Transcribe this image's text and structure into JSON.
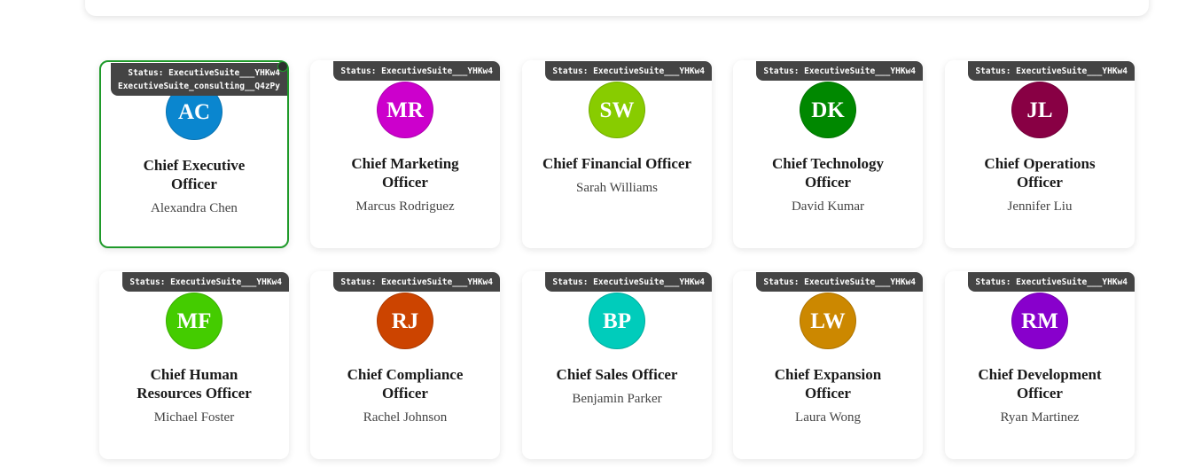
{
  "badge_status": "Status: ExecutiveSuite___YHKw4",
  "badge_extra": "ExecutiveSuite_consulting__Q4zPy",
  "cards": [
    {
      "initials": "AC",
      "color": "#0a86cf",
      "title": "Chief Executive Officer",
      "name": "Alexandra Chen",
      "selected": true
    },
    {
      "initials": "MR",
      "color": "#cc00cc",
      "title": "Chief Marketing Officer",
      "name": "Marcus Rodriguez",
      "selected": false
    },
    {
      "initials": "SW",
      "color": "#88cc00",
      "title": "Chief Financial Officer",
      "name": "Sarah Williams",
      "selected": false
    },
    {
      "initials": "DK",
      "color": "#008800",
      "title": "Chief Technology Officer",
      "name": "David Kumar",
      "selected": false
    },
    {
      "initials": "JL",
      "color": "#880044",
      "title": "Chief Operations Officer",
      "name": "Jennifer Liu",
      "selected": false
    },
    {
      "initials": "MF",
      "color": "#44cc00",
      "title": "Chief Human Resources Officer",
      "name": "Michael Foster",
      "selected": false
    },
    {
      "initials": "RJ",
      "color": "#cc4400",
      "title": "Chief Compliance Officer",
      "name": "Rachel Johnson",
      "selected": false
    },
    {
      "initials": "BP",
      "color": "#00ccbb",
      "title": "Chief Sales Officer",
      "name": "Benjamin Parker",
      "selected": false
    },
    {
      "initials": "LW",
      "color": "#cc8800",
      "title": "Chief Expansion Officer",
      "name": "Laura Wong",
      "selected": false
    },
    {
      "initials": "RM",
      "color": "#8800cc",
      "title": "Chief Development Officer",
      "name": "Ryan Martinez",
      "selected": false
    }
  ]
}
